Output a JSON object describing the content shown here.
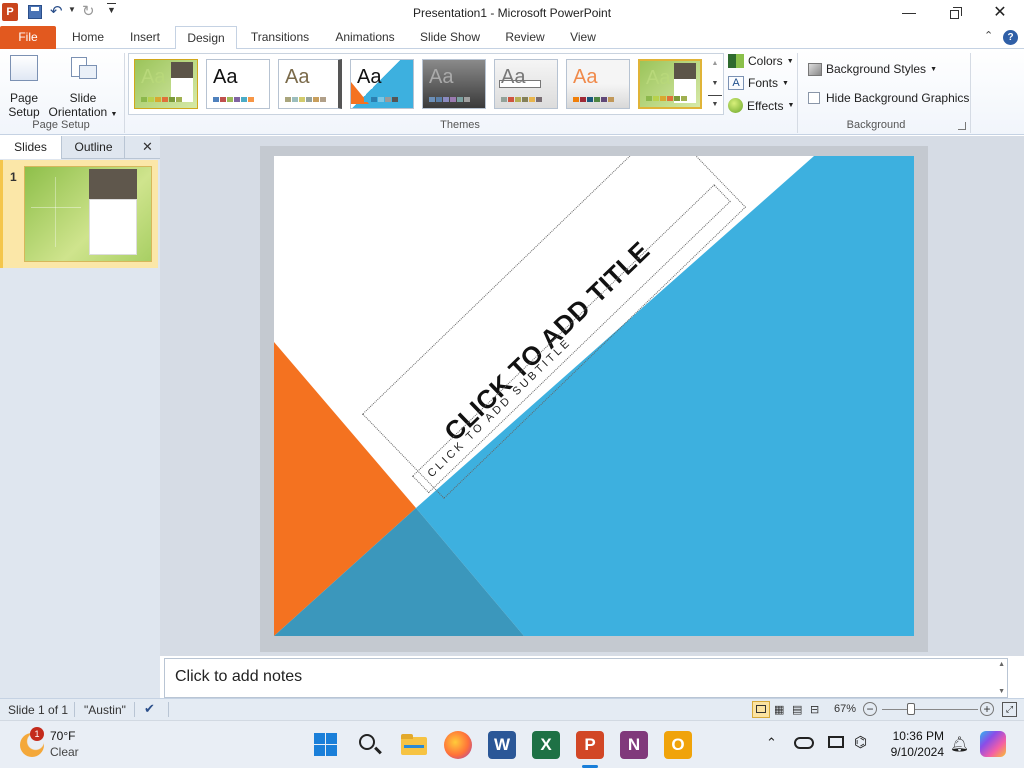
{
  "window": {
    "title": "Presentation1 - Microsoft PowerPoint",
    "app_icon_letter": "P"
  },
  "tabs": [
    "File",
    "Home",
    "Insert",
    "Design",
    "Transitions",
    "Animations",
    "Slide Show",
    "Review",
    "View"
  ],
  "active_tab": "Design",
  "ribbon": {
    "page_setup": {
      "page_setup_label": "Page\nSetup",
      "page_setup_line1": "Page",
      "page_setup_line2": "Setup",
      "slide_orientation_line1": "Slide",
      "slide_orientation_line2": "Orientation",
      "group_label": "Page Setup"
    },
    "themes": {
      "group_label": "Themes",
      "items": [
        {
          "aa": "Aa",
          "style": "green"
        },
        {
          "aa": "Aa",
          "style": "office"
        },
        {
          "aa": "Aa",
          "style": "adjacency"
        },
        {
          "aa": "Aa",
          "style": "angles"
        },
        {
          "aa": "Aa",
          "style": "apex"
        },
        {
          "aa": "Aa",
          "style": "apothecary"
        },
        {
          "aa": "Aa",
          "style": "aspect"
        },
        {
          "aa": "Aa",
          "style": "austin"
        }
      ],
      "colors_label": "Colors",
      "fonts_label": "Fonts",
      "effects_label": "Effects"
    },
    "background": {
      "styles_label": "Background Styles",
      "hide_graphics_label": "Hide Background Graphics",
      "group_label": "Background"
    }
  },
  "pane": {
    "slides_tab": "Slides",
    "outline_tab": "Outline",
    "slide_number": "1"
  },
  "slide": {
    "title_placeholder": "CLICK TO ADD TITLE",
    "subtitle_placeholder": "CLICK TO ADD SUBTITLE"
  },
  "notes": {
    "placeholder": "Click to add notes"
  },
  "status": {
    "slide_info": "Slide 1 of 1",
    "theme_name": "\"Austin\"",
    "zoom": "67%"
  },
  "taskbar": {
    "weather_temp": "70°F",
    "weather_desc": "Clear",
    "weather_badge": "1",
    "time": "10:36 PM",
    "date": "9/10/2024"
  },
  "colors": {
    "file_tab": "#e2591f",
    "slide_blue": "#3db0df",
    "slide_orange": "#f47220",
    "slide_teal": "#3b97bc"
  }
}
